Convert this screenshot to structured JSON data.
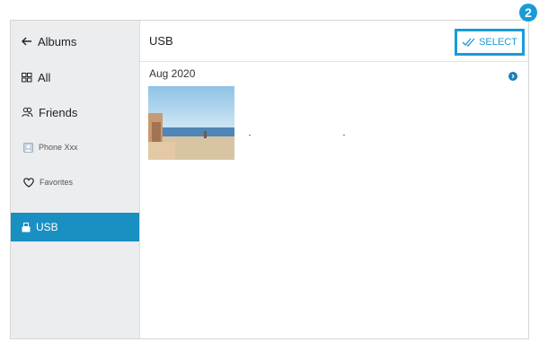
{
  "sidebar": {
    "back_label": "Albums",
    "items": [
      {
        "label": "All",
        "icon": "grid-icon"
      },
      {
        "label": "Friends",
        "icon": "people-icon"
      },
      {
        "label": "Phone Xxx",
        "icon": "phone-album-icon"
      },
      {
        "label": "Favorites",
        "icon": "heart-icon"
      },
      {
        "label": "USB",
        "icon": "usb-icon",
        "selected": true
      }
    ]
  },
  "header": {
    "title": "USB",
    "select_label": "SELECT",
    "select_icon": "double-check-icon"
  },
  "callout_badge": "2",
  "content": {
    "groups": [
      {
        "date": "Aug 2020",
        "photo_count": 1
      }
    ]
  },
  "colors": {
    "accent": "#1a9bd7",
    "selected_bg": "#1a8fc2",
    "sidebar_bg": "#ecedef"
  }
}
